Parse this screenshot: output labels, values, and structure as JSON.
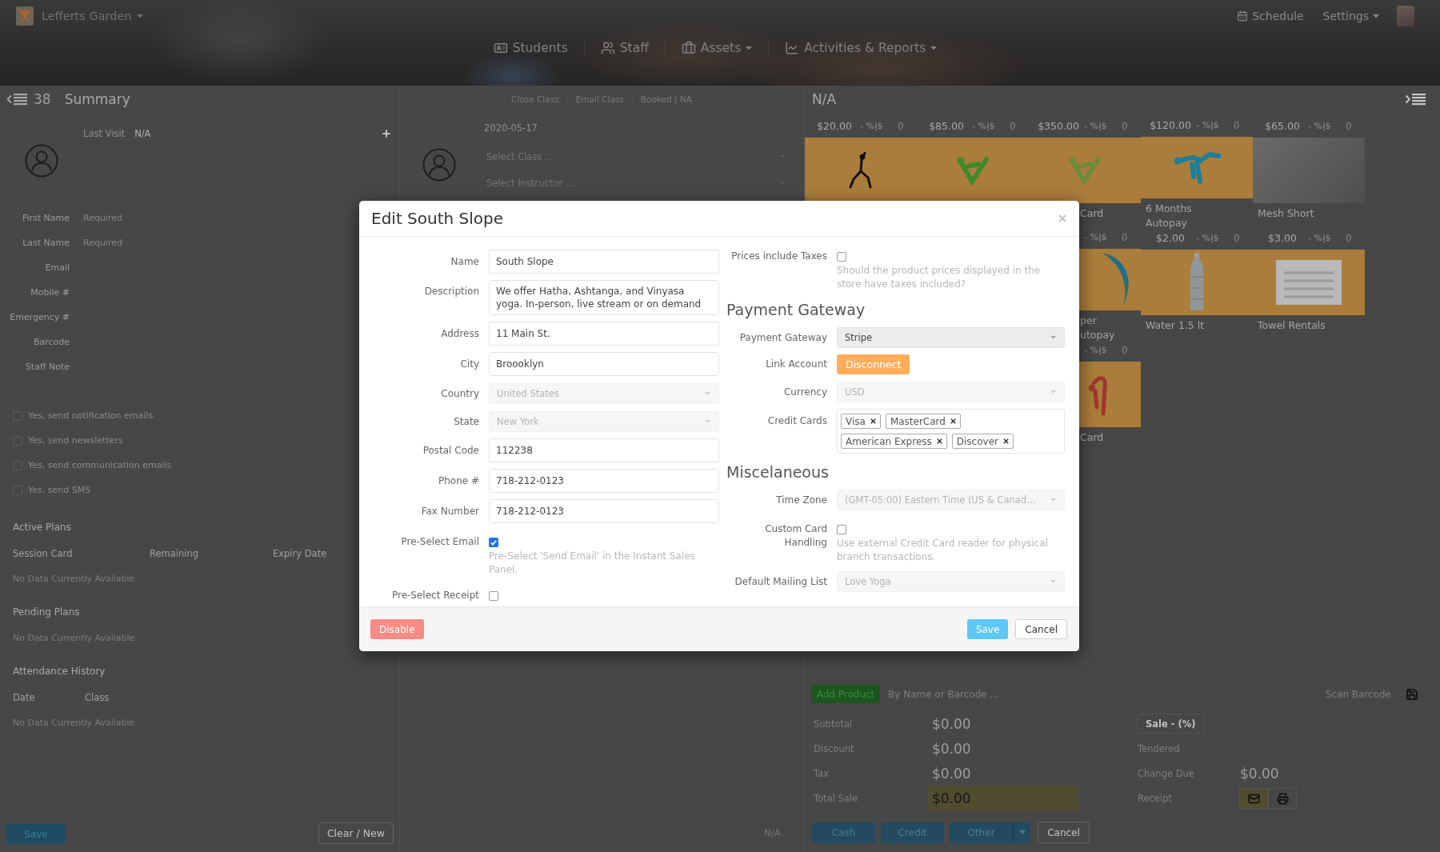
{
  "top_bar": {
    "location": "Lefferts Garden",
    "schedule": "Schedule",
    "settings": "Settings"
  },
  "nav": [
    {
      "label": "Students",
      "has_menu": false
    },
    {
      "label": "Staff",
      "has_menu": false
    },
    {
      "label": "Assets",
      "has_menu": true
    },
    {
      "label": "Activities & Reports",
      "has_menu": true
    }
  ],
  "summary": {
    "count": "38",
    "title": "Summary",
    "last_visit_label": "Last Visit",
    "last_visit": "N/A",
    "fields": [
      {
        "label": "First Name",
        "placeholder": "Required"
      },
      {
        "label": "Last Name",
        "placeholder": "Required"
      },
      {
        "label": "Email"
      },
      {
        "label": "Mobile #"
      },
      {
        "label": "Emergency #"
      },
      {
        "label": "Barcode"
      },
      {
        "label": "Staff Note"
      }
    ],
    "options": [
      {
        "label": "Yes, send notification emails",
        "checked": false
      },
      {
        "label": "Yes, send newsletters",
        "checked": false
      },
      {
        "label": "Yes, send communication emails",
        "checked": false
      },
      {
        "label": "Yes, send SMS",
        "checked": false
      }
    ],
    "sections": [
      {
        "title": "Active Plans",
        "columns": [
          "Session Card",
          "Remaining",
          "Expiry Date"
        ],
        "empty": "No Data Currently Available."
      },
      {
        "title": "Pending Plans",
        "empty": "No Data Currently Available."
      },
      {
        "title": "Attendance History",
        "columns": [
          "Date",
          "Class"
        ],
        "empty": "No Data Currently Available."
      }
    ],
    "save": "Save",
    "clear": "Clear / New"
  },
  "class_panel": {
    "actions": [
      "Close Class",
      "Email Class",
      "Booked | NA"
    ],
    "date": "2020-05-17",
    "selects": [
      {
        "placeholder": "Select Class ..."
      },
      {
        "placeholder": "Select Instructor ..."
      }
    ],
    "status": "N/A"
  },
  "pos": {
    "title": "N/A",
    "product_rows": [
      [
        {
          "price": "$20.00",
          "discount": "- %|$",
          "quantity": "0"
        },
        {
          "price": "$85.00",
          "discount": "- %|$",
          "quantity": "0"
        },
        {
          "price": "$350.00",
          "discount": "- %|$",
          "quantity": "0",
          "name": "Card"
        },
        {
          "price": "$120.00",
          "discount": "- %|$",
          "quantity": "0",
          "name": "6 Months Autopay"
        },
        {
          "price": "$65.00",
          "discount": "- %|$",
          "quantity": "0",
          "name": "Mesh Short"
        }
      ],
      [
        {
          "discount": "- %|$",
          "quantity": "0",
          "name": "per utopay"
        },
        {
          "price": "$2.00",
          "discount": "- %|$",
          "quantity": "0",
          "name": "Water 1.5 lt"
        },
        {
          "price": "$3.00",
          "discount": "- %|$",
          "quantity": "0",
          "name": "Towel Rentals"
        }
      ],
      [
        {
          "discount": "- %|$",
          "quantity": "0",
          "name": "Card"
        }
      ]
    ],
    "add_product": "Add Product",
    "search": {
      "placeholder": "By Name or Barcode ..."
    },
    "scan": {
      "placeholder": "Scan Barcode"
    },
    "totals": [
      {
        "label": "Subtotal",
        "value": "$0.00",
        "highlighted": false
      },
      {
        "label": "Discount",
        "value": "$0.00",
        "highlighted": false
      },
      {
        "label": "Tax",
        "value": "$0.00",
        "highlighted": false
      },
      {
        "label": "Total Sale",
        "value": "$0.00",
        "highlighted": true
      }
    ],
    "sale_type": "Sale - (%)",
    "payment": [
      {
        "label": "Tendered"
      },
      {
        "label": "Change Due",
        "value": "$0.00"
      },
      {
        "label": "Receipt"
      }
    ],
    "receipt_options": [
      {
        "selected": true
      },
      {
        "selected": false
      }
    ],
    "pay_buttons": [
      {
        "label": "Cash",
        "has_menu": false
      },
      {
        "label": "Credit",
        "has_menu": false
      },
      {
        "label": "Other",
        "has_menu": true
      }
    ],
    "cancel": "Cancel"
  },
  "modal": {
    "title": "Edit South Slope",
    "left_fields": [
      {
        "kind": "text",
        "label": "Name",
        "value": "South Slope"
      },
      {
        "kind": "textarea",
        "label": "Description",
        "value": "We offer Hatha, Ashtanga, and Vinyasa yoga. In-person, live stream or on demand"
      },
      {
        "kind": "text",
        "label": "Address",
        "value": "11 Main St."
      },
      {
        "kind": "text",
        "label": "City",
        "value": "Broooklyn"
      },
      {
        "kind": "select",
        "label": "Country",
        "value": "United States",
        "disabled": true
      },
      {
        "kind": "select",
        "label": "State",
        "value": "New York",
        "disabled": true
      },
      {
        "kind": "text",
        "label": "Postal Code",
        "value": "112238"
      },
      {
        "kind": "text",
        "label": "Phone #",
        "value": "718-212-0123"
      },
      {
        "kind": "text",
        "label": "Fax Number",
        "value": "718-212-0123"
      },
      {
        "kind": "checkbox",
        "label": "Pre-Select Email",
        "checked": true,
        "help": "Pre-Select 'Send Email' in the Instant Sales Panel."
      },
      {
        "kind": "checkbox",
        "label": "Pre-Select Receipt",
        "checked": false
      }
    ],
    "right_fields": [
      {
        "kind": "checkbox",
        "label": "Prices include Taxes",
        "checked": false,
        "help": "Should the product prices displayed in the store have taxes included?"
      },
      {
        "kind": "heading",
        "label": "Payment Gateway"
      },
      {
        "kind": "select",
        "label": "Payment Gateway",
        "value": "Stripe",
        "disabled": false
      },
      {
        "kind": "button",
        "label": "Link Account",
        "value": "Disconnect"
      },
      {
        "kind": "select",
        "label": "Currency",
        "value": "USD",
        "disabled": true
      },
      {
        "kind": "tags",
        "label": "Credit Cards",
        "tags": [
          "Visa",
          "MasterCard",
          "American Express",
          "Discover"
        ]
      },
      {
        "kind": "heading",
        "label": "Miscelaneous"
      },
      {
        "kind": "select",
        "label": "Time Zone",
        "value": "(GMT-05:00) Eastern Time (US & Canad…",
        "disabled": true
      },
      {
        "kind": "checkbox",
        "label": "Custom Card Handling",
        "checked": false,
        "help": "Use external Credit Card reader for physical branch transactions."
      },
      {
        "kind": "select",
        "label": "Default Mailing List",
        "value": "Love Yoga",
        "disabled": true
      }
    ],
    "actions": {
      "disable": "Disable",
      "save": "Save",
      "cancel": "Cancel"
    }
  }
}
